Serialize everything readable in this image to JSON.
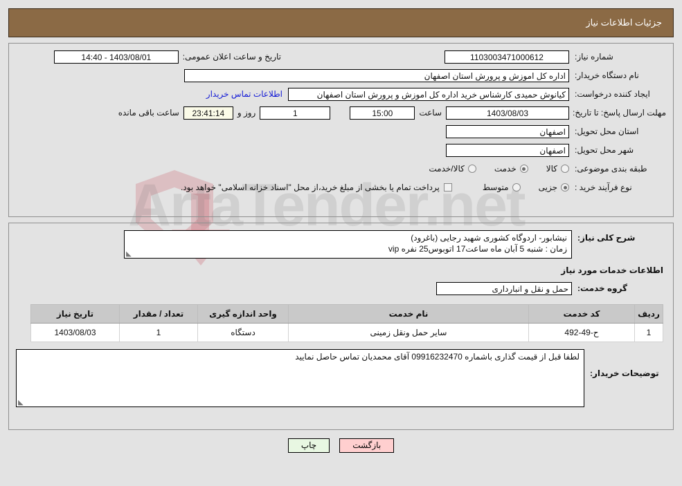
{
  "header": {
    "title": "جزئیات اطلاعات نیاز"
  },
  "info": {
    "need_number_label": "شماره نیاز:",
    "need_number_value": "1103003471000612",
    "publish_label": "تاریخ و ساعت اعلان عمومی:",
    "publish_value": "1403/08/01 - 14:40",
    "buyer_org_label": "نام دستگاه خریدار:",
    "buyer_org_value": "اداره کل اموزش و پرورش استان اصفهان",
    "creator_label": "ایجاد کننده درخواست:",
    "creator_value": "کیانوش حمیدی کارشناس خرید اداره کل اموزش و پرورش استان اصفهان",
    "contact_link": "اطلاعات تماس خریدار",
    "deadline_label": "مهلت ارسال پاسخ: تا تاریخ:",
    "deadline_date": "1403/08/03",
    "hour_label": "ساعت",
    "deadline_time": "15:00",
    "days_value": "1",
    "days_text": "روز و",
    "countdown_value": "23:41:14",
    "remaining_text": "ساعت باقی مانده",
    "province_label": "استان محل تحویل:",
    "province_value": "اصفهان",
    "city_label": "شهر محل تحویل:",
    "city_value": "اصفهان",
    "category_label": "طبقه بندی موضوعی:",
    "category_options": [
      {
        "label": "کالا",
        "selected": false
      },
      {
        "label": "خدمت",
        "selected": true
      },
      {
        "label": "کالا/خدمت",
        "selected": false
      }
    ],
    "process_label": "نوع فرآیند خرید :",
    "process_options": [
      {
        "label": "جزیی",
        "selected": true
      },
      {
        "label": "متوسط",
        "selected": false
      }
    ],
    "treasury_checkbox_text": "پرداخت تمام یا بخشی از مبلغ خرید،از محل \"اسناد خزانه اسلامی\" خواهد بود."
  },
  "detail": {
    "description_label": "شرح کلی نیاز:",
    "description_line1": "نیشابور- اردوگاه کشوری شهید رجایی (باغرود)",
    "description_line2": "زمان : شنبه 5 آبان ماه ساعت17 اتوبوس25 نفره vip",
    "services_section_title": "اطلاعات خدمات مورد نیاز",
    "service_group_label": "گروه خدمت:",
    "service_group_value": "حمل و نقل و انبارداری",
    "notes_label": "توضیحات خریدار:",
    "notes_value": "لطفا قبل از قیمت گذاری باشماره 09916232470 آقای محمدیان تماس حاصل نمایید"
  },
  "table": {
    "headers": [
      "ردیف",
      "کد خدمت",
      "نام خدمت",
      "واحد اندازه گیری",
      "تعداد / مقدار",
      "تاریخ نیاز"
    ],
    "rows": [
      {
        "radif": "1",
        "code": "ح-49-492",
        "name": "سایر حمل ونقل زمینی",
        "unit": "دستگاه",
        "qty": "1",
        "date": "1403/08/03"
      }
    ]
  },
  "footer": {
    "back_label": "بازگشت",
    "print_label": "چاپ"
  },
  "watermark": {
    "text": "ArtaTender.net"
  },
  "colors": {
    "header_bar": "#8b6a45",
    "page_bg": "#e3e3e3",
    "link": "#1219d6",
    "back_button": "#ffcfcf",
    "print_button": "#e8f7e2",
    "countdown_bg": "#fbfbe8",
    "table_header_bg": "#c9c9c9"
  }
}
